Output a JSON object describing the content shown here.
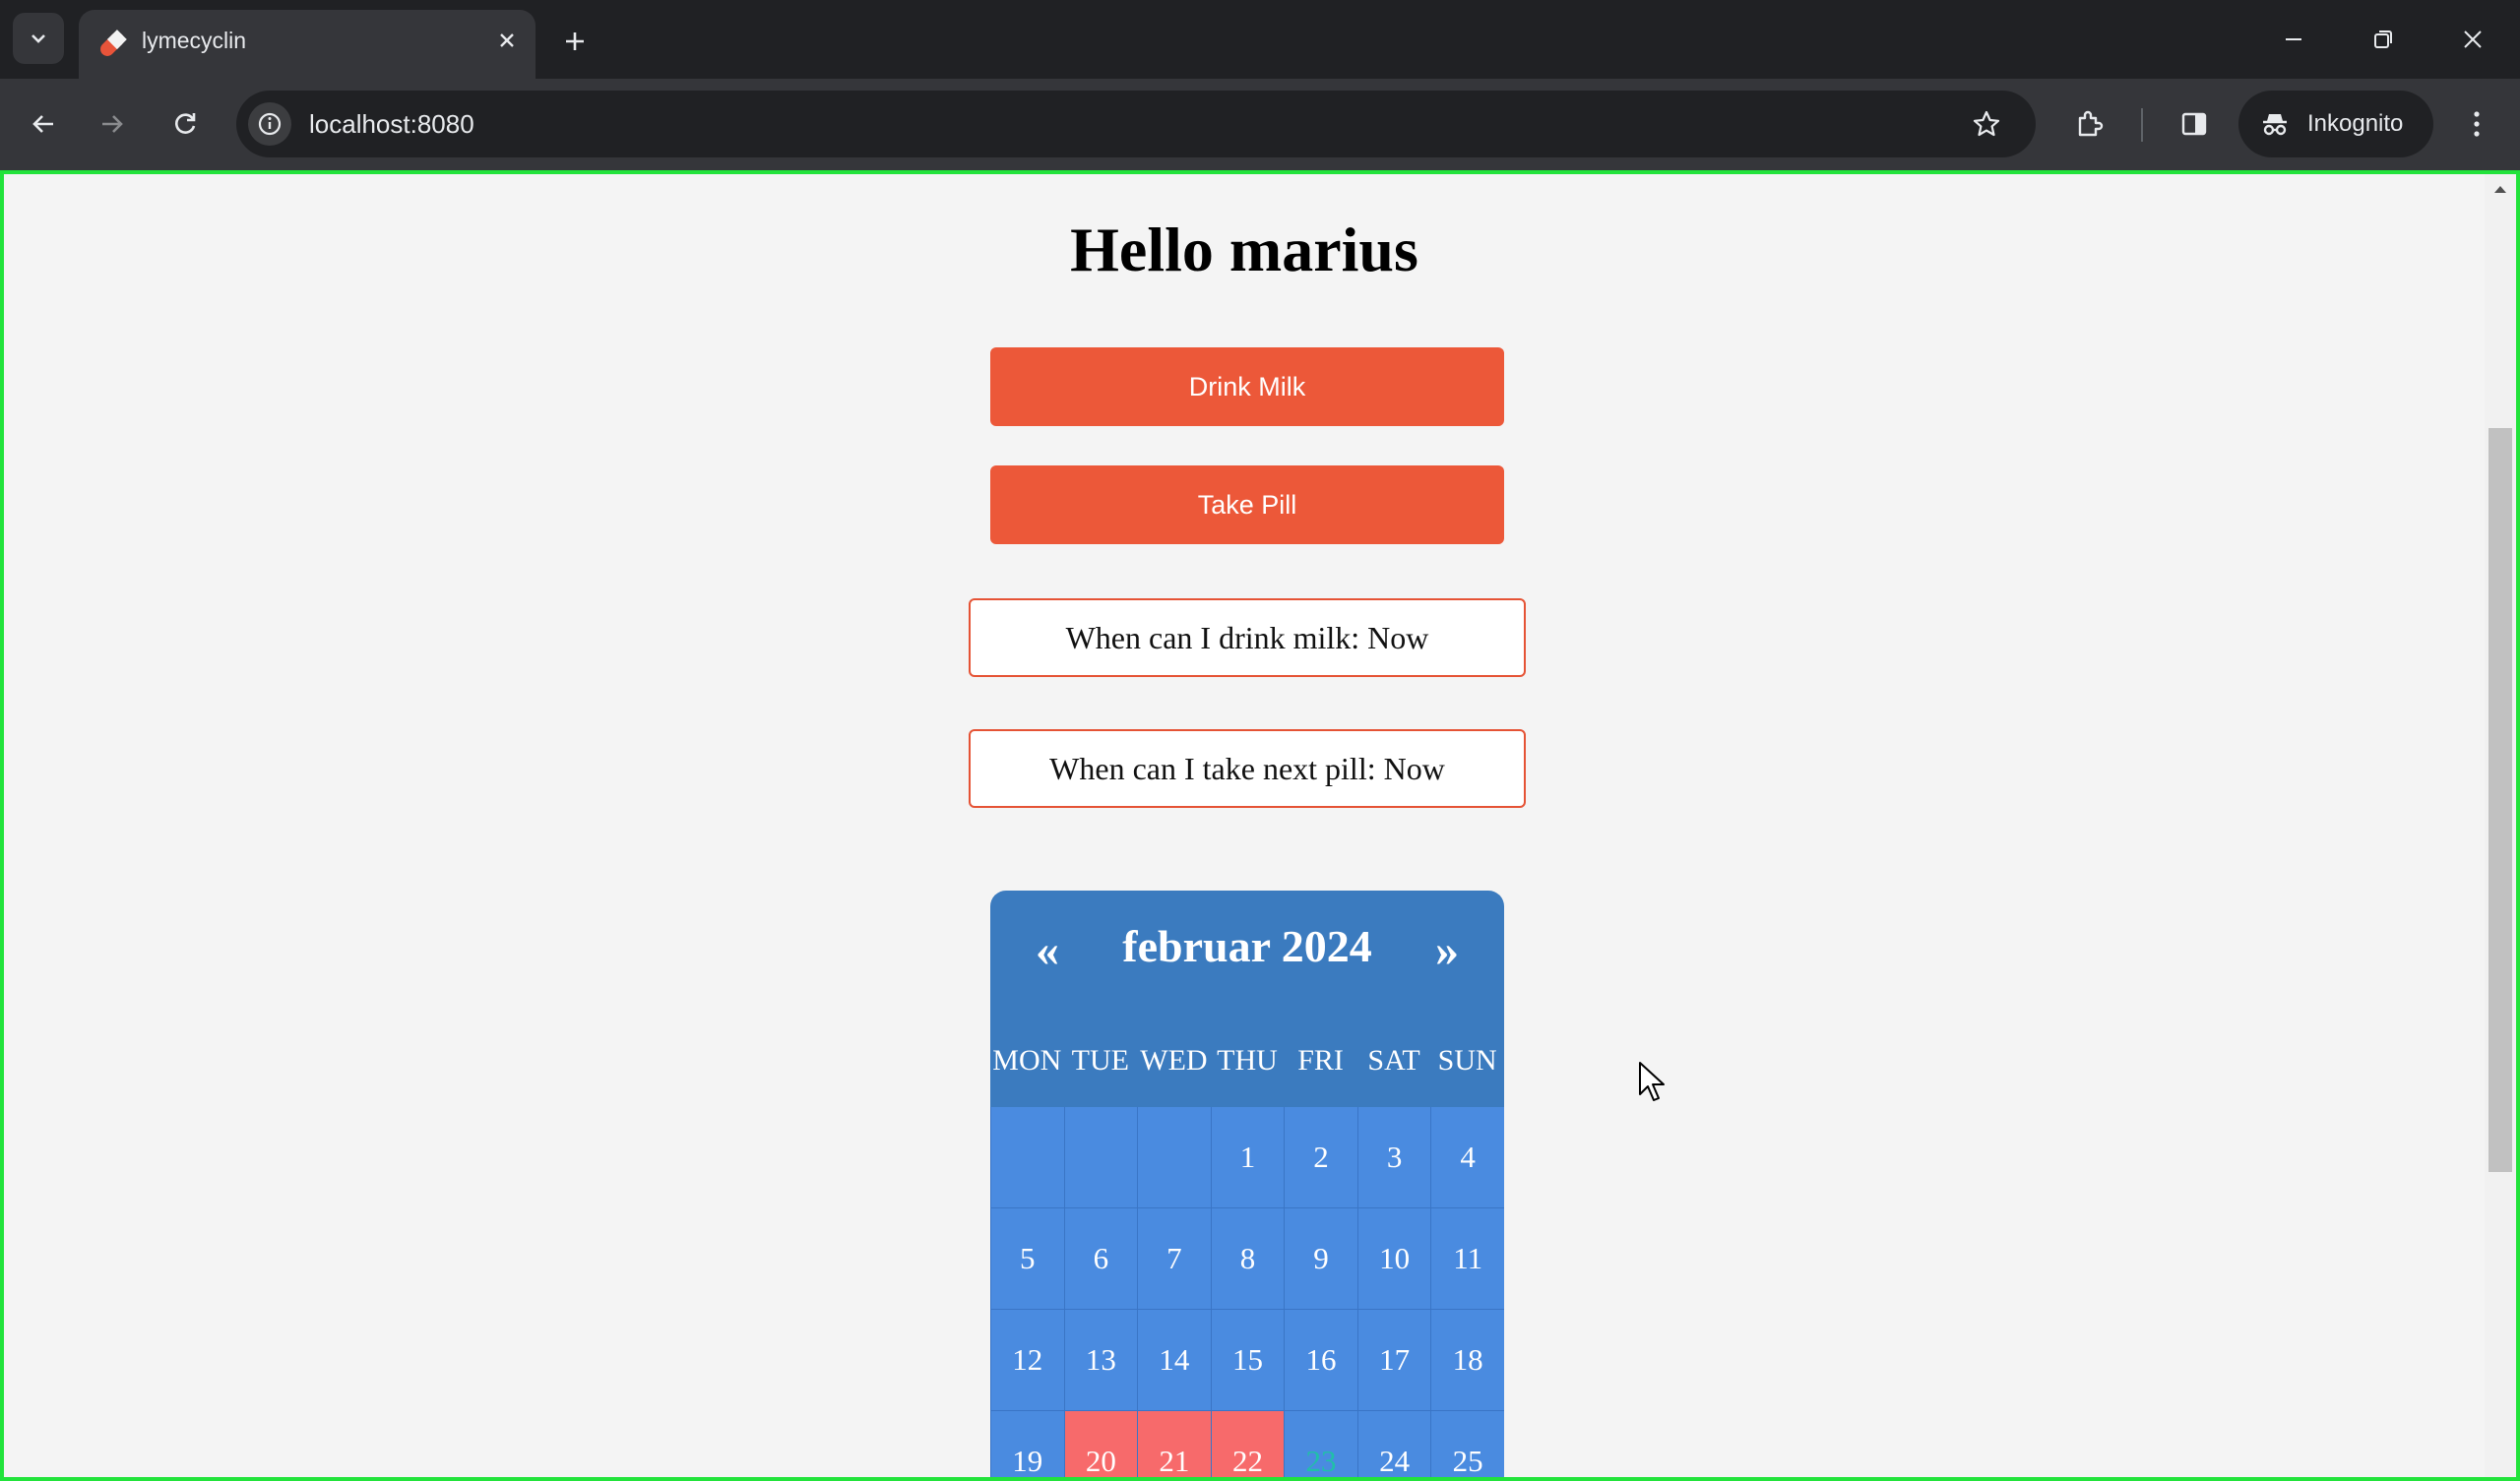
{
  "browser": {
    "tab_title": "lymecyclin",
    "url": "localhost:8080",
    "incognito_label": "Inkognito"
  },
  "page": {
    "greeting": "Hello marius",
    "buttons": {
      "drink_milk": "Drink Milk",
      "take_pill": "Take Pill"
    },
    "status": {
      "milk": "When can I drink milk: Now",
      "pill": "When can I take next pill: Now"
    }
  },
  "calendar": {
    "prev": "«",
    "next": "»",
    "title": "februar 2024",
    "day_names": [
      "MON",
      "TUE",
      "WED",
      "THU",
      "FRI",
      "SAT",
      "SUN"
    ],
    "weeks": [
      [
        "",
        "",
        "",
        "1",
        "2",
        "3",
        "4"
      ],
      [
        "5",
        "6",
        "7",
        "8",
        "9",
        "10",
        "11"
      ],
      [
        "12",
        "13",
        "14",
        "15",
        "16",
        "17",
        "18"
      ],
      [
        "19",
        "20",
        "21",
        "22",
        "23",
        "24",
        "25"
      ]
    ],
    "marked_days": [
      "20",
      "21",
      "22"
    ],
    "today": "23",
    "colors": {
      "header": "#3b7bbf",
      "cell": "#4a8be0",
      "marked": "#f76a6b",
      "today_text": "#20c0a8",
      "button": "#ec5839"
    }
  }
}
